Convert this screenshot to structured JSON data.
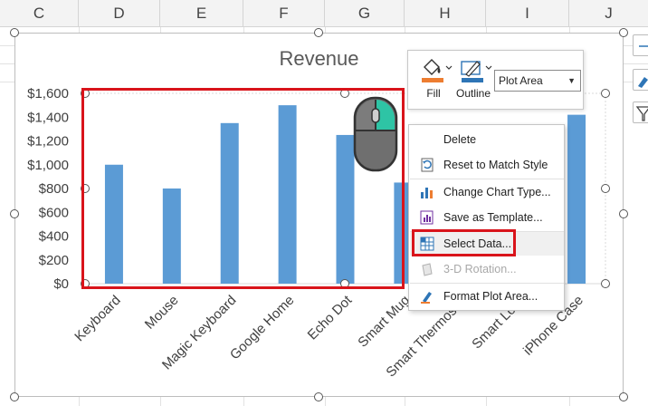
{
  "sheet": {
    "columns": [
      "C",
      "D",
      "E",
      "F",
      "G",
      "H",
      "I",
      "J"
    ]
  },
  "chart": {
    "title": "Revenue"
  },
  "chart_data": {
    "type": "bar",
    "title": "Revenue",
    "categories": [
      "Keyboard",
      "Mouse",
      "Magic Keyboard",
      "Google Home",
      "Echo Dot",
      "Smart Mug",
      "Smart Thermostat",
      "Smart Lock",
      "iPhone Case"
    ],
    "values": [
      1000,
      800,
      1350,
      1500,
      1250,
      850,
      null,
      null,
      1420
    ],
    "y_tick_labels": [
      "$0",
      "$200",
      "$400",
      "$600",
      "$800",
      "$1,000",
      "$1,200",
      "$1,400",
      "$1,600"
    ],
    "ylim": [
      0,
      1600
    ],
    "bar_color": "#5b9bd5",
    "grid": false
  },
  "toolbar": {
    "fill_label": "Fill",
    "outline_label": "Outline",
    "element_selected": "Plot Area"
  },
  "context_menu": {
    "items": [
      {
        "label": "Delete",
        "icon": "delete-icon",
        "enabled": true
      },
      {
        "label": "Reset to Match Style",
        "icon": "reset-style-icon",
        "enabled": true
      },
      {
        "label": "Change Chart Type...",
        "icon": "change-chart-type-icon",
        "enabled": true
      },
      {
        "label": "Save as Template...",
        "icon": "save-template-icon",
        "enabled": true
      },
      {
        "label": "Select Data...",
        "icon": "select-data-icon",
        "enabled": true
      },
      {
        "label": "3-D Rotation...",
        "icon": "rotation-3d-icon",
        "enabled": false
      },
      {
        "label": "Format Plot Area...",
        "icon": "format-plot-area-icon",
        "enabled": true
      }
    ]
  },
  "colors": {
    "accent_red": "#d9141b",
    "bar_blue": "#5b9bd5",
    "fill_orange": "#ed7d31",
    "outline_blue": "#2e75b6"
  }
}
